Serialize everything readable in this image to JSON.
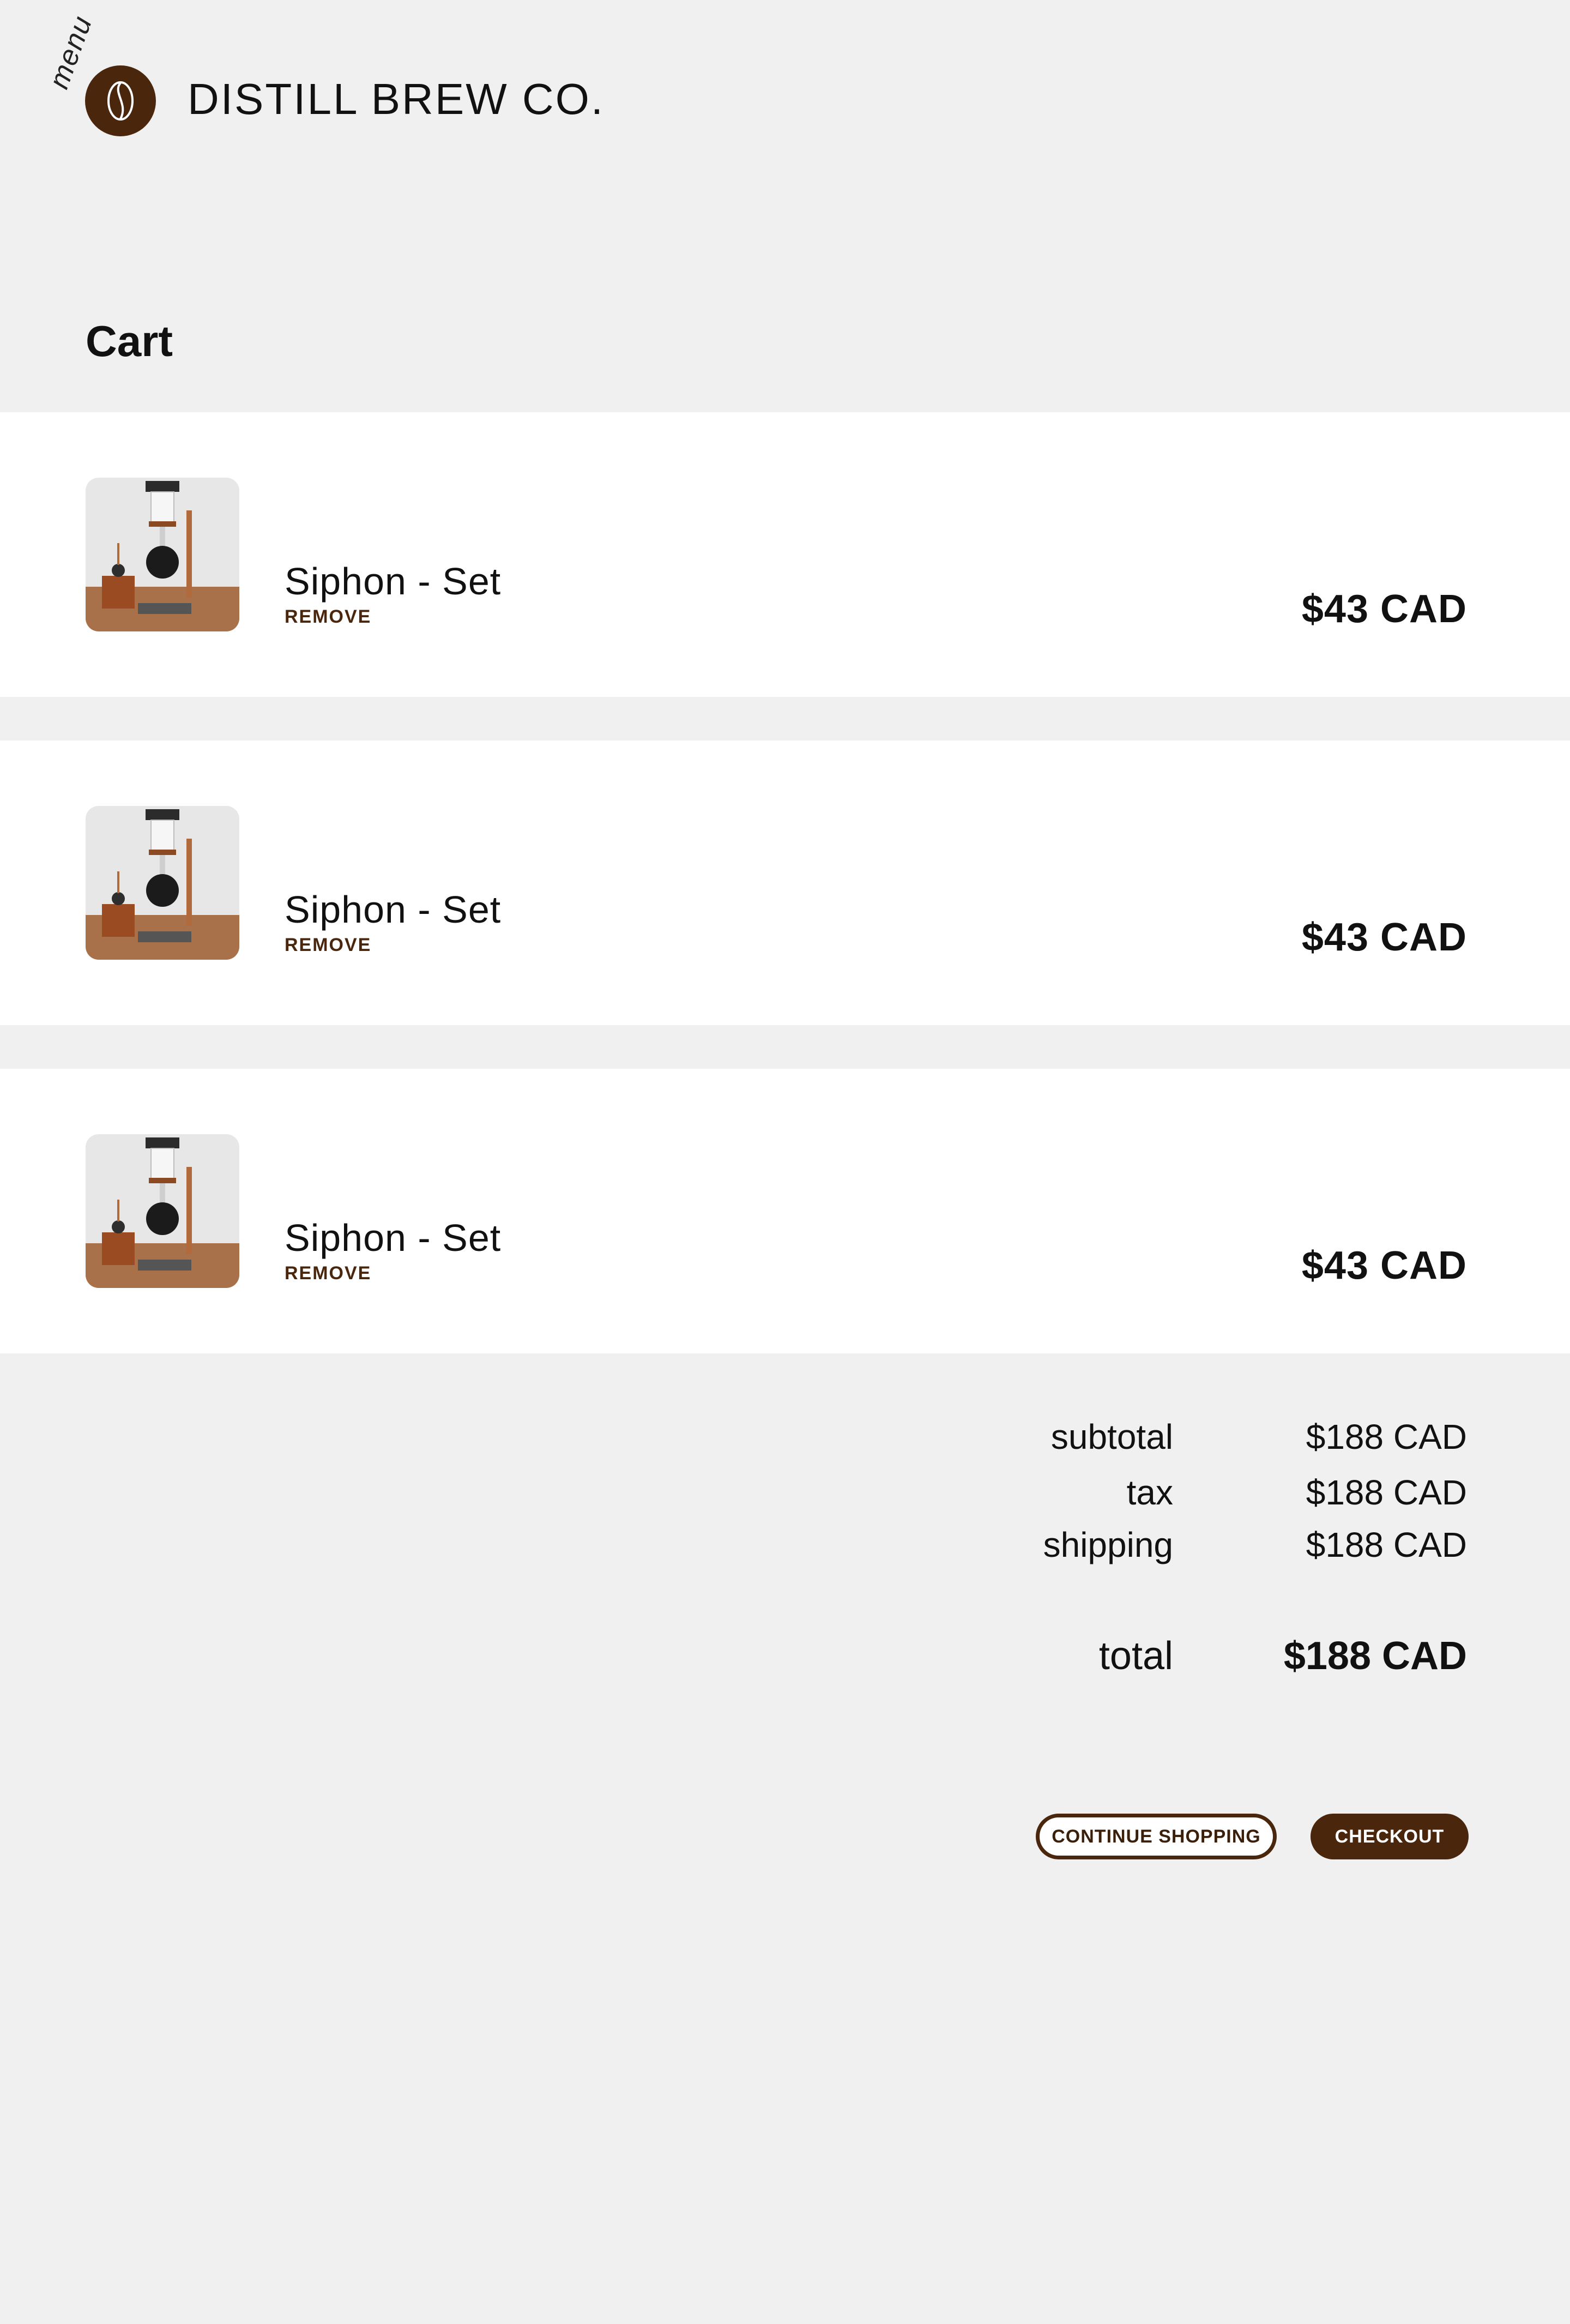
{
  "header": {
    "menu_label": "menu",
    "brand_name": "DISTILL BREW CO."
  },
  "page": {
    "title": "Cart"
  },
  "cart": {
    "items": [
      {
        "name": "Siphon - Set",
        "remove_label": "REMOVE",
        "price": "$43 CAD"
      },
      {
        "name": "Siphon - Set",
        "remove_label": "REMOVE",
        "price": "$43 CAD"
      },
      {
        "name": "Siphon - Set",
        "remove_label": "REMOVE",
        "price": "$43 CAD"
      }
    ]
  },
  "summary": {
    "subtotal_label": "subtotal",
    "subtotal_value": "$188 CAD",
    "tax_label": "tax",
    "tax_value": "$188 CAD",
    "shipping_label": "shipping",
    "shipping_value": "$188 CAD",
    "total_label": "total",
    "total_value": "$188 CAD"
  },
  "actions": {
    "continue_label": "CONTINUE SHOPPING",
    "checkout_label": "CHECKOUT"
  },
  "colors": {
    "accent": "#4a260d",
    "background": "#f0f0f0",
    "card": "#ffffff"
  }
}
